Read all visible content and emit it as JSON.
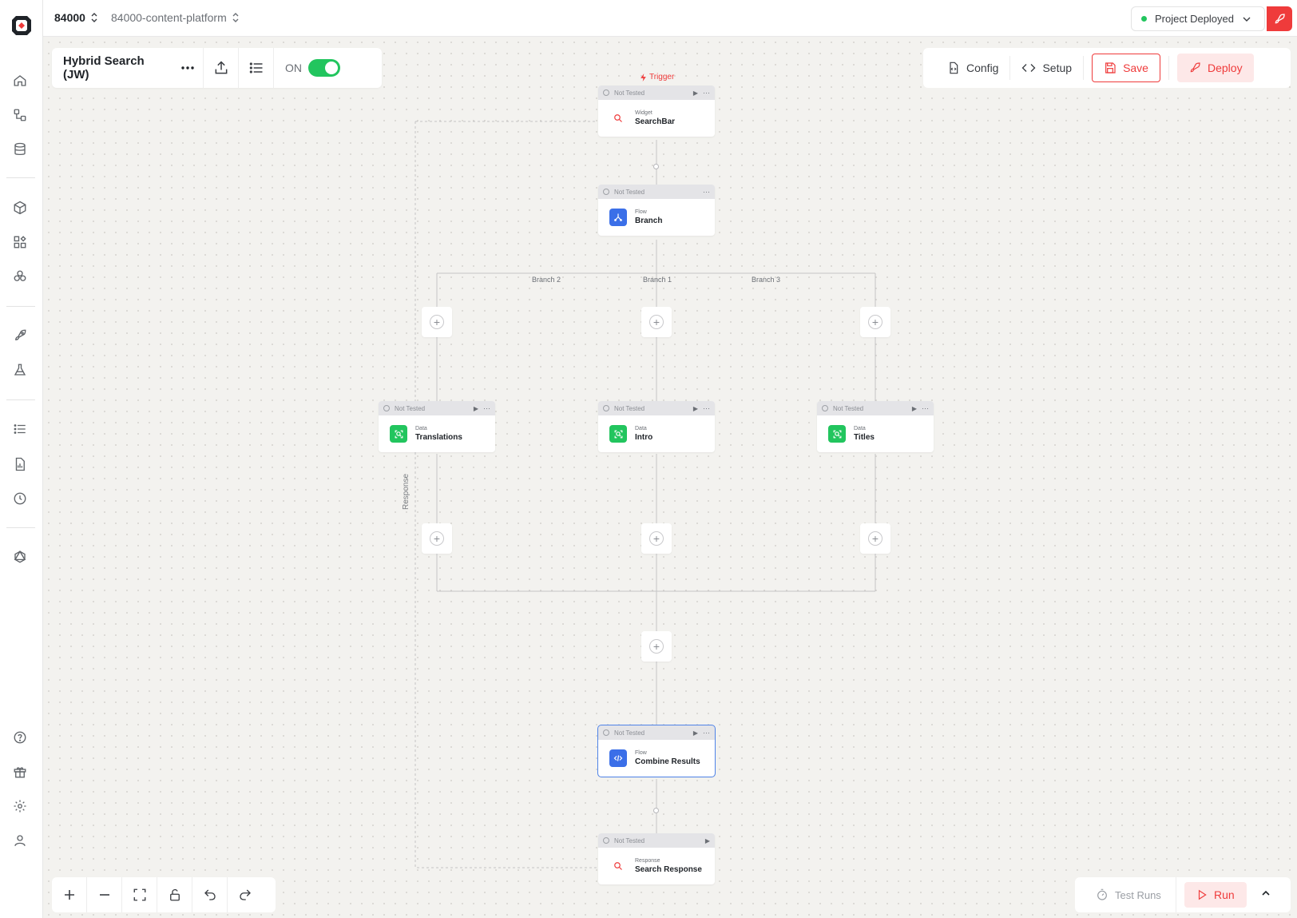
{
  "topbar": {
    "org": "84000",
    "project": "84000-content-platform",
    "deploy_status": "Project Deployed"
  },
  "toolbar": {
    "workflow_title": "Hybrid Search (JW)",
    "toggle_label": "ON",
    "toggle_on": true,
    "config_label": "Config",
    "setup_label": "Setup",
    "save_label": "Save",
    "deploy_label": "Deploy"
  },
  "bottom": {
    "test_runs_label": "Test Runs",
    "run_label": "Run"
  },
  "flow": {
    "trigger_label": "Trigger",
    "response_label": "Response",
    "branch_labels": [
      "Branch 2",
      "Branch 1",
      "Branch 3"
    ],
    "nodes": [
      {
        "status": "Not Tested",
        "category": "Widget",
        "name": "SearchBar",
        "icon": "search-icon"
      },
      {
        "status": "Not Tested",
        "category": "Flow",
        "name": "Branch",
        "icon": "branch-icon"
      },
      {
        "status": "Not Tested",
        "category": "Data",
        "name": "Translations",
        "icon": "data-search-icon"
      },
      {
        "status": "Not Tested",
        "category": "Data",
        "name": "Intro",
        "icon": "data-search-icon"
      },
      {
        "status": "Not Tested",
        "category": "Data",
        "name": "Titles",
        "icon": "data-search-icon"
      },
      {
        "status": "Not Tested",
        "category": "Flow",
        "name": "Combine Results",
        "icon": "code-icon"
      },
      {
        "status": "Not Tested",
        "category": "Response",
        "name": "Search Response",
        "icon": "search-icon"
      }
    ]
  },
  "colors": {
    "accent": "#ef3b3b",
    "success": "#22c55e",
    "flow_blue": "#3b6fe8",
    "canvas": "#f3f2ef"
  }
}
